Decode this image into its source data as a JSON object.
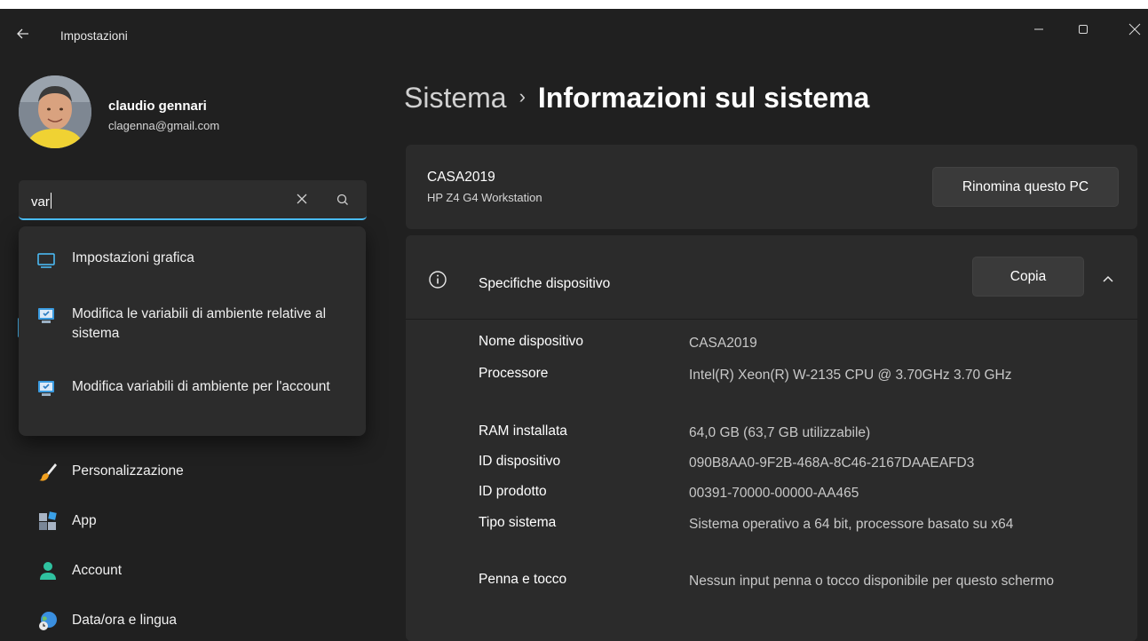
{
  "window": {
    "title": "Impostazioni"
  },
  "user": {
    "name": "claudio gennari",
    "email": "clagenna@gmail.com"
  },
  "search": {
    "value": "var"
  },
  "suggestions": [
    {
      "label": "Impostazioni grafica",
      "icon": "display-icon"
    },
    {
      "label": "Modifica le variabili di ambiente relative al sistema",
      "icon": "system-properties-icon"
    },
    {
      "label": "Modifica variabili di ambiente per l'account",
      "icon": "system-properties-icon"
    }
  ],
  "nav": [
    {
      "label": "Personalizzazione",
      "icon": "brush-icon"
    },
    {
      "label": "App",
      "icon": "apps-icon"
    },
    {
      "label": "Account",
      "icon": "account-icon"
    },
    {
      "label": "Data/ora e lingua",
      "icon": "globe-clock-icon"
    }
  ],
  "breadcrumb": {
    "parent": "Sistema",
    "separator": "›",
    "current": "Informazioni sul sistema"
  },
  "pc": {
    "name": "CASA2019",
    "model": "HP Z4 G4 Workstation",
    "rename_label": "Rinomina questo PC"
  },
  "specs": {
    "title": "Specifiche dispositivo",
    "copy_label": "Copia",
    "rows": [
      {
        "label": "Nome dispositivo",
        "value": "CASA2019"
      },
      {
        "label": "Processore",
        "value": "Intel(R) Xeon(R) W-2135 CPU @ 3.70GHz   3.70 GHz"
      },
      {
        "label": "RAM installata",
        "value": "64,0 GB (63,7 GB utilizzabile)"
      },
      {
        "label": "ID dispositivo",
        "value": "090B8AA0-9F2B-468A-8C46-2167DAAEAFD3"
      },
      {
        "label": "ID prodotto",
        "value": "00391-70000-00000-AA465"
      },
      {
        "label": "Tipo sistema",
        "value": "Sistema operativo a 64 bit, processore basato su x64"
      },
      {
        "label": "Penna e tocco",
        "value": "Nessun input penna o tocco disponibile per questo schermo"
      }
    ]
  },
  "colors": {
    "accent": "#4cc2ff",
    "background": "#202020",
    "card": "#2b2b2b"
  }
}
